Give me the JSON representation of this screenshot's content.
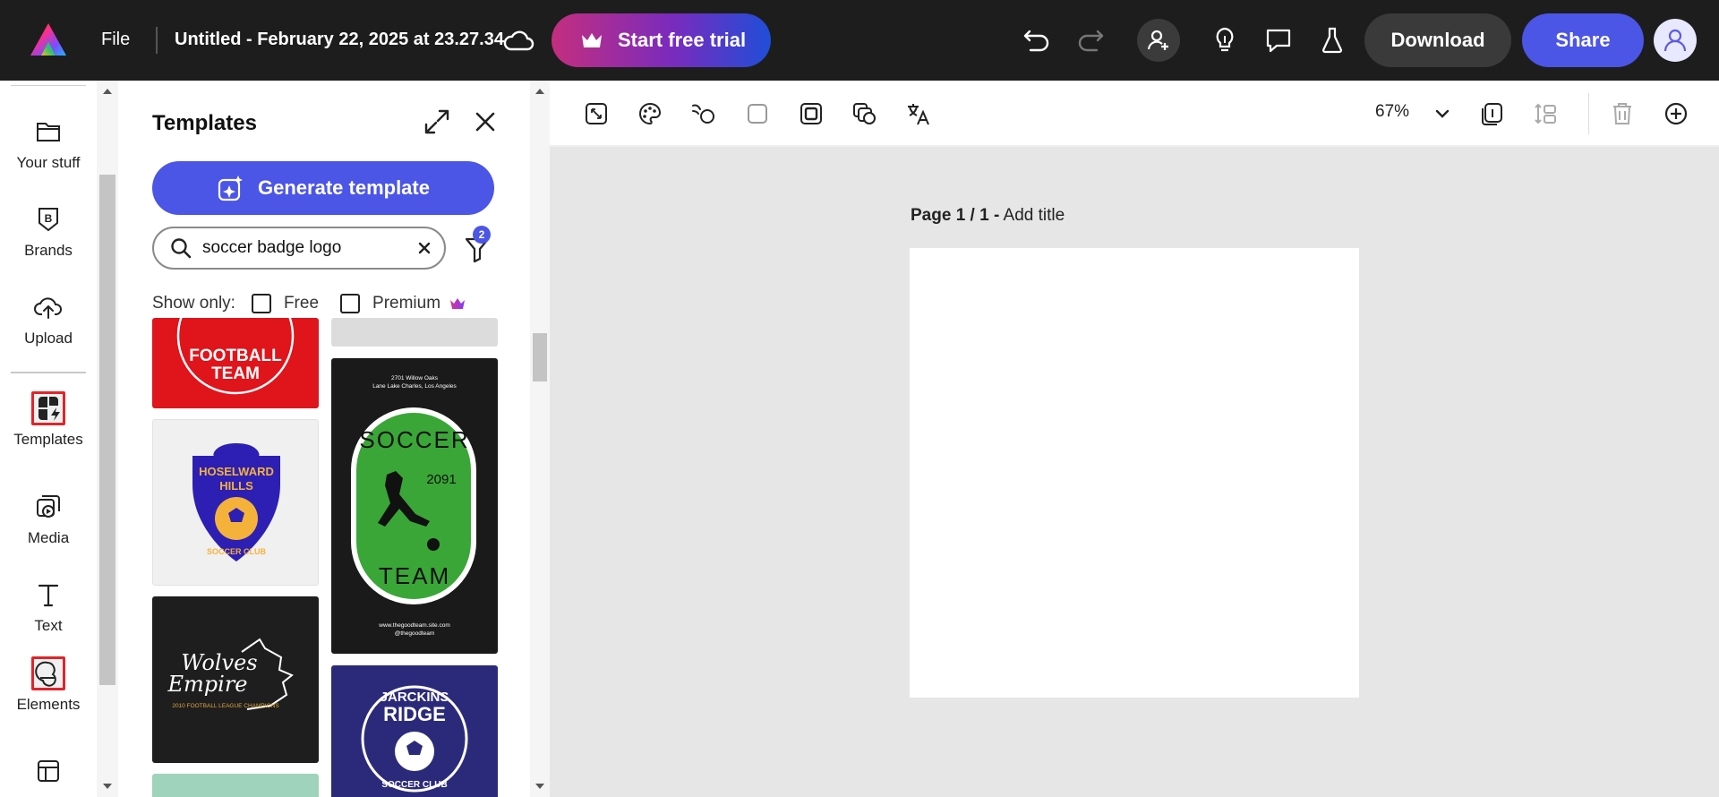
{
  "topbar": {
    "file_label": "File",
    "document_title": "Untitled - February 22, 2025 at 23.27.34",
    "trial_label": "Start free trial",
    "download_label": "Download",
    "share_label": "Share",
    "brand_gradient": [
      "#ff3b30",
      "#ffcc00",
      "#34c759",
      "#5856d6"
    ]
  },
  "rail": {
    "items": [
      {
        "label": "Your stuff",
        "icon": "folder-icon"
      },
      {
        "label": "Brands",
        "icon": "brand-icon"
      },
      {
        "label": "Upload",
        "icon": "upload-cloud-icon"
      },
      {
        "label": "Templates",
        "icon": "templates-icon",
        "selected": true
      },
      {
        "label": "Media",
        "icon": "media-icon"
      },
      {
        "label": "Text",
        "icon": "text-icon"
      },
      {
        "label": "Elements",
        "icon": "elements-icon",
        "selected": true
      }
    ]
  },
  "panel": {
    "title": "Templates",
    "generate_label": "Generate template",
    "search_value": "soccer badge logo",
    "filter_count": "2",
    "show_only_label": "Show only:",
    "free_label": "Free",
    "premium_label": "Premium"
  },
  "templates": [
    {
      "name": "football-team",
      "lines": [
        "FOOTBALL",
        "TEAM"
      ],
      "bg": "#e0141b"
    },
    {
      "name": "hoselward-hills",
      "lines": [
        "HOSELWARD",
        "HILLS",
        "SOCCER CLUB"
      ],
      "bg": "#f0f0f0"
    },
    {
      "name": "wolves-empire",
      "lines": [
        "Wolves",
        "Empire",
        "2010 FOOTBALL LEAGUE CHAMPIONS"
      ],
      "bg": "#1e1e1e"
    },
    {
      "name": "soccer-team",
      "lines": [
        "2701 Willow Oaks",
        "Lane Lake Charles, Los Angeles",
        "SOCCER",
        "TEAM",
        "2091",
        "www.thegoodteam.site.com",
        "@thegoodteam"
      ],
      "bg": "#1a1a1a"
    },
    {
      "name": "jarckins-ridge",
      "lines": [
        "JARCKINS",
        "RIDGE",
        "SOCCER CLUB"
      ],
      "bg": "#2b2a7a"
    }
  ],
  "canvas": {
    "zoom": "67%",
    "page_label": "Page 1 / 1 -",
    "add_title": "Add title"
  }
}
